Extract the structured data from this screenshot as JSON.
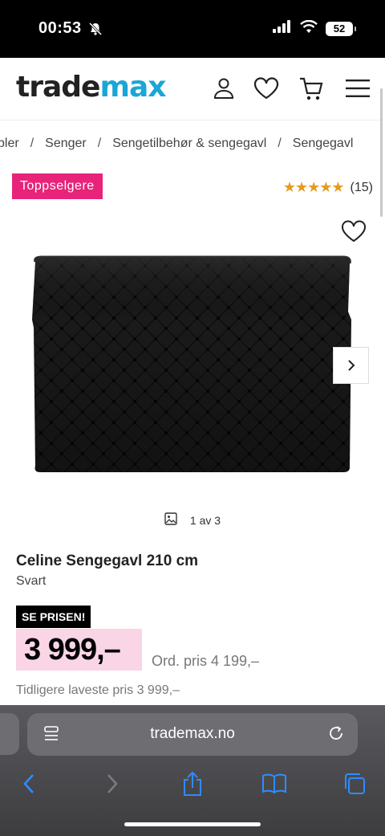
{
  "status": {
    "time": "00:53",
    "battery": "52"
  },
  "header": {
    "logo_trade": "trade",
    "logo_max": "max",
    "icons": [
      "user-icon",
      "heart-icon",
      "cart-icon",
      "menu-icon"
    ]
  },
  "breadcrumb": {
    "items": [
      "bler",
      "Senger",
      "Sengetilbehør & sengegavl",
      "Sengegavl"
    ],
    "separator": "/"
  },
  "badge": "Toppselgere",
  "rating": {
    "stars": "★★★★★",
    "count": "(15)"
  },
  "gallery": {
    "counter": "1 av 3"
  },
  "product": {
    "title": "Celine Sengegavl 210 cm",
    "variant": "Svart",
    "see_price_label": "SE PRISEN!",
    "price": "3 999,–",
    "ord_price": "Ord. pris 4 199,–",
    "prev_lowest": "Tidligere laveste pris 3 999,–"
  },
  "browser": {
    "url": "trademax.no"
  },
  "colors": {
    "brand_blue": "#1aa6d6",
    "badge_pink": "#e8247a",
    "price_bg": "#f9d5e5",
    "star": "#e89a1c"
  }
}
